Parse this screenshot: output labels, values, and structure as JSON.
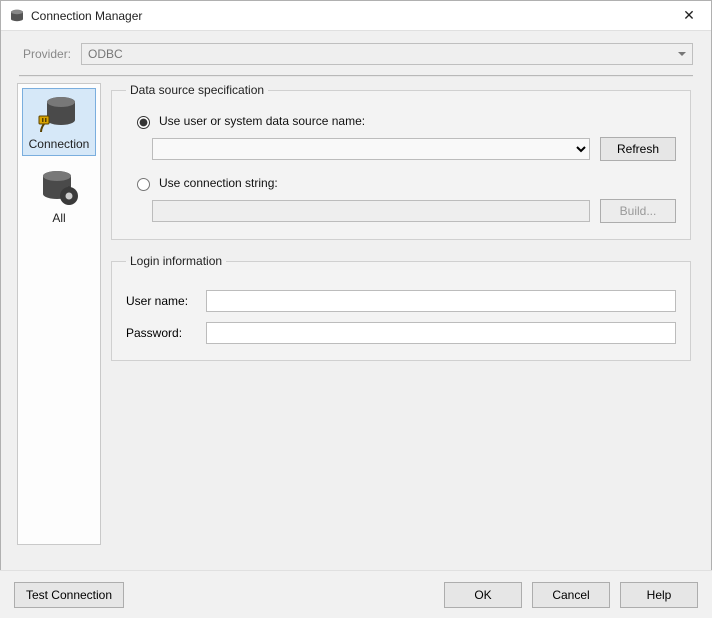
{
  "window": {
    "title": "Connection Manager",
    "close_label": "✕"
  },
  "provider": {
    "label": "Provider:",
    "selected": "ODBC"
  },
  "nav": {
    "items": [
      {
        "label": "Connection",
        "selected": true
      },
      {
        "label": "All",
        "selected": false
      }
    ]
  },
  "panels": {
    "datasource": {
      "legend": "Data source specification",
      "radio_dsn_label": "Use user or system data source name:",
      "radio_cs_label": "Use connection string:",
      "dsn_selected": "",
      "refresh_label": "Refresh",
      "cs_value": "",
      "build_label": "Build..."
    },
    "login": {
      "legend": "Login information",
      "user_label": "User name:",
      "user_value": "",
      "password_label": "Password:",
      "password_value": ""
    }
  },
  "footer": {
    "test_label": "Test Connection",
    "ok_label": "OK",
    "cancel_label": "Cancel",
    "help_label": "Help"
  }
}
